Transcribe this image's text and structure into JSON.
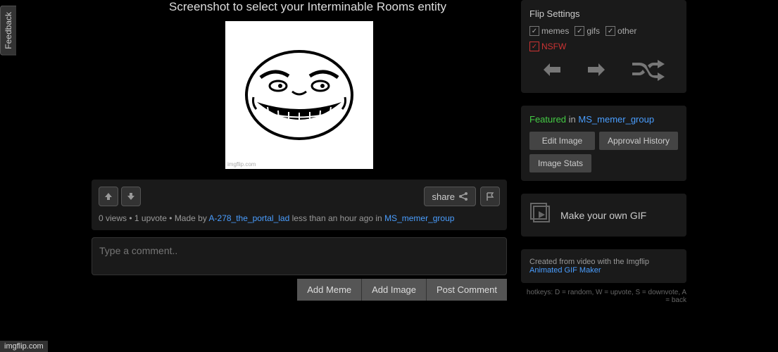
{
  "feedback": "Feedback",
  "title": "Screenshot to select your Interminable Rooms entity",
  "image_watermark": "imgflip.com",
  "share_label": "share",
  "meta": {
    "views": "0 views",
    "upvotes": "1 upvote",
    "made_by": "Made by",
    "author": "A-278_the_portal_lad",
    "time": "less than an hour ago in",
    "stream": "MS_memer_group"
  },
  "comment_placeholder": "Type a comment..",
  "buttons": {
    "add_meme": "Add Meme",
    "add_image": "Add Image",
    "post_comment": "Post Comment"
  },
  "flip": {
    "title": "Flip Settings",
    "memes": "memes",
    "gifs": "gifs",
    "other": "other",
    "nsfw": "NSFW"
  },
  "featured": {
    "label": "Featured",
    "in": "in",
    "stream": "MS_memer_group",
    "edit": "Edit Image",
    "approval": "Approval History",
    "stats": "Image Stats"
  },
  "gif": {
    "text": "Make your own GIF"
  },
  "created": {
    "text": "Created from video with the Imgflip ",
    "link": "Animated GIF Maker"
  },
  "hotkeys": "hotkeys: D = random, W = upvote, S = downvote, A = back",
  "footer": "imgflip.com"
}
